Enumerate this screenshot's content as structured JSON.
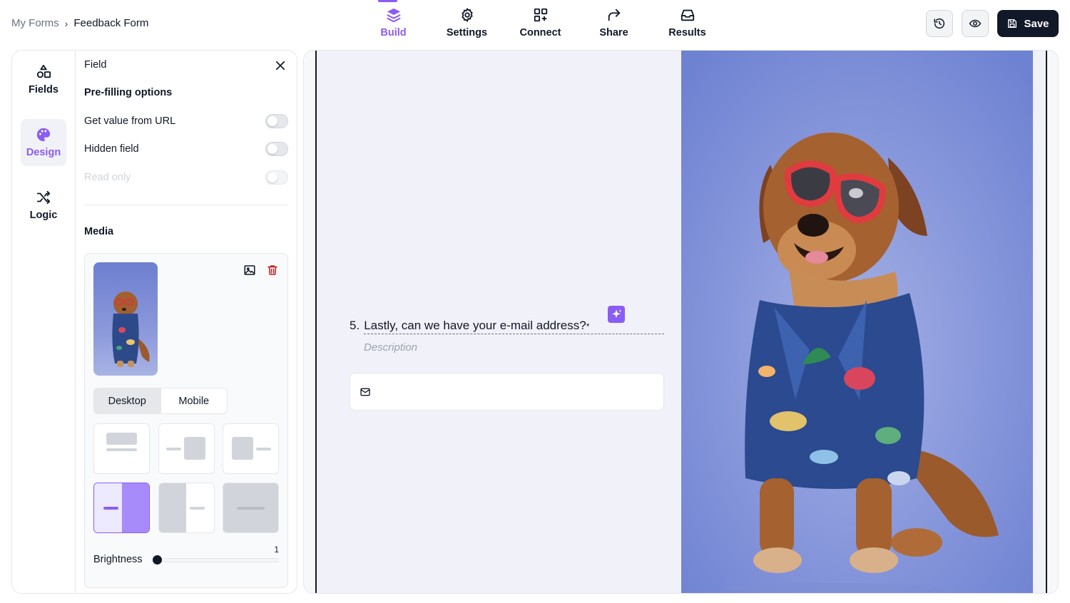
{
  "breadcrumb": {
    "parent": "My Forms",
    "separator": "›",
    "current": "Feedback Form"
  },
  "topnav": [
    {
      "label": "Build",
      "icon": "layers-icon",
      "active": true
    },
    {
      "label": "Settings",
      "icon": "gear-icon",
      "active": false
    },
    {
      "label": "Connect",
      "icon": "grid-plus-icon",
      "active": false
    },
    {
      "label": "Share",
      "icon": "share-arrow-icon",
      "active": false
    },
    {
      "label": "Results",
      "icon": "inbox-icon",
      "active": false
    }
  ],
  "actions": {
    "history_icon": "history-icon",
    "preview_icon": "eye-icon",
    "save_label": "Save"
  },
  "rail": [
    {
      "label": "Fields",
      "icon": "shapes-icon",
      "active": false
    },
    {
      "label": "Design",
      "icon": "palette-icon",
      "active": true
    },
    {
      "label": "Logic",
      "icon": "shuffle-icon",
      "active": false
    }
  ],
  "field_panel": {
    "header": "Field",
    "prefill_title": "Pre-filling options",
    "toggles": [
      {
        "label": "Get value from URL",
        "on": false,
        "disabled": false
      },
      {
        "label": "Hidden field",
        "on": false,
        "disabled": false
      },
      {
        "label": "Read only",
        "on": false,
        "disabled": true
      }
    ],
    "media_title": "Media",
    "media_tabs": [
      "Desktop",
      "Mobile"
    ],
    "selected_tab": "Desktop",
    "selected_layout": 4,
    "brightness_label": "Brightness",
    "brightness_value": "1"
  },
  "question": {
    "number": "5.",
    "text": "Lastly, can we have your e-mail address?",
    "required_mark": "*",
    "description_placeholder": "Description",
    "input_icon": "mail-icon"
  },
  "colors": {
    "accent": "#8b5cf6",
    "dark": "#111827",
    "canvas_bg": "#f1f1f9",
    "photo_bg": "#8797dc"
  }
}
